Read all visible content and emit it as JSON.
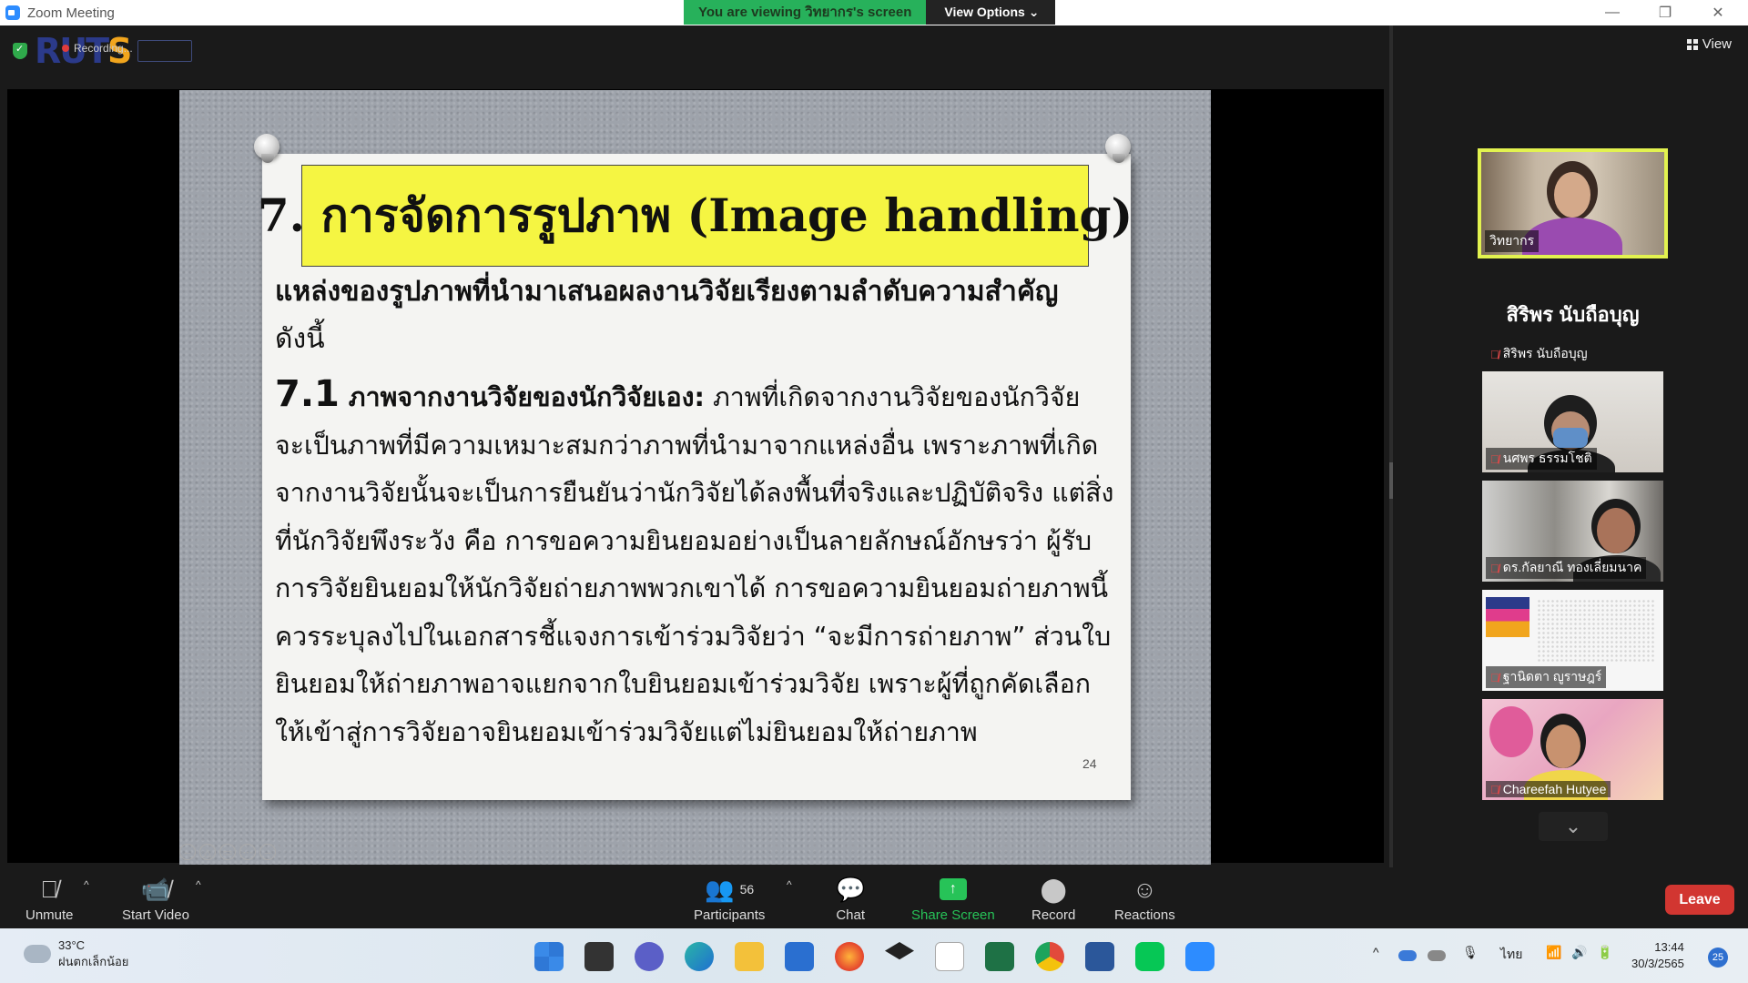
{
  "window": {
    "title": "Zoom Meeting"
  },
  "share_banner": {
    "viewing_text": "You are viewing วิทยากร's screen",
    "view_options_label": "View Options"
  },
  "recording": {
    "logo_text_blue": "RUT",
    "logo_text_orange": "S",
    "label": "Recording..."
  },
  "slide": {
    "title": "7. การจัดการรูปภาพ (Image handling)",
    "lead_line1": "แหล่งของรูปภาพที่นำมาเสนอผลงานวิจัยเรียงตามลำดับความสำคัญ",
    "lead_line2": "ดังนี้",
    "section_number": "7.1",
    "section_heading": " ภาพจากงานวิจัยของนักวิจัยเอง:",
    "section_lines": [
      " ภาพที่เกิดจากงานวิจัยของนักวิจัย",
      "จะเป็นภาพที่มีความเหมาะสมกว่าภาพที่นำมาจากแหล่งอื่น เพราะภาพที่เกิด",
      "จากงานวิจัยนั้นจะเป็นการยืนยันว่านักวิจัยได้ลงพื้นที่จริงและปฏิบัติจริง แต่สิ่ง",
      "ที่นักวิจัยพึงระวัง คือ การขอความยินยอมอย่างเป็นลายลักษณ์อักษรว่า ผู้รับ",
      "การวิจัยยินยอมให้นักวิจัยถ่ายภาพพวกเขาได้ การขอความยินยอมถ่ายภาพนี้",
      "ควรระบุลงไปในเอกสารชี้แจงการเข้าร่วมวิจัยว่า “จะมีการถ่ายภาพ” ส่วนใบ",
      "ยินยอมให้ถ่ายภาพอาจแยกจากใบยินยอมเข้าร่วมวิจัย เพราะผู้ที่ถูกคัดเลือก",
      "ให้เข้าสู่การวิจัยอาจยินยอมเข้าร่วมวิจัยแต่ไม่ยินยอมให้ถ่ายภาพ"
    ],
    "page_number": "24",
    "background_color": "#9ea3ab",
    "title_bg_color": "#f5f542"
  },
  "right_panel": {
    "view_label": "View",
    "active_speaker": "วิทยากร",
    "participants": [
      {
        "name": "สิริพร นับถือบุญ",
        "display": "สิริพร นับถือบุญ",
        "muted": true
      },
      {
        "name": "นศพร ธรรมโชติ",
        "muted": true
      },
      {
        "name": "ดร.กัลยาณี ทองเลี่ยมนาค",
        "muted": true
      },
      {
        "name": "ฐานิดตา ญูราษฎร์",
        "muted": true
      },
      {
        "name": "Chareefah Hutyee",
        "muted": true
      }
    ]
  },
  "toolbar": {
    "unmute_label": "Unmute",
    "start_video_label": "Start Video",
    "participants_label": "Participants",
    "participants_count": "56",
    "chat_label": "Chat",
    "share_screen_label": "Share Screen",
    "record_label": "Record",
    "reactions_label": "Reactions",
    "leave_label": "Leave",
    "leave_color": "#d23631",
    "share_color": "#27c358"
  },
  "taskbar": {
    "temperature": "33°C",
    "weather_text": "ฝนตกเล็กน้อย",
    "language": "ไทย",
    "time": "13:44",
    "date": "30/3/2565",
    "notification_count": "25"
  }
}
